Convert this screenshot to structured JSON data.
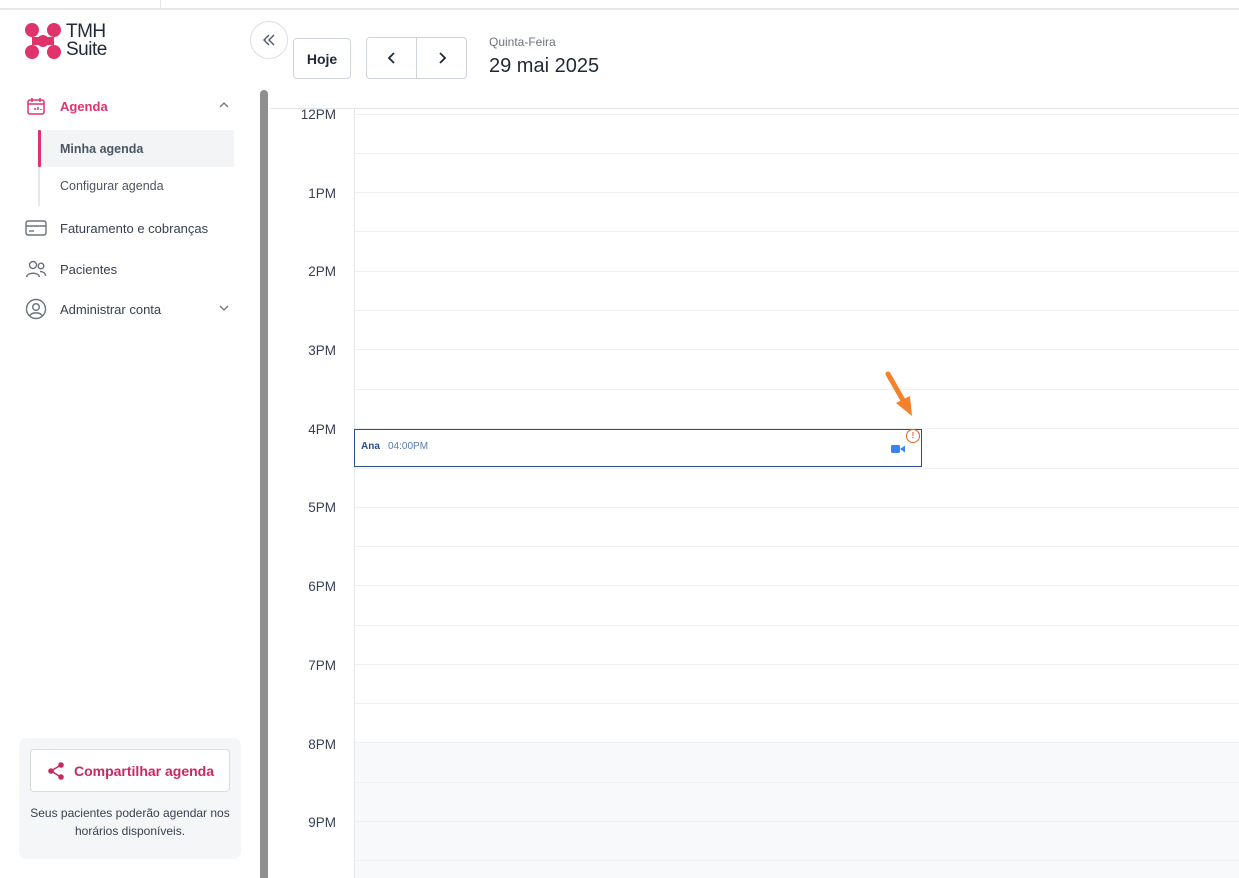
{
  "brand": {
    "name_line1": "TMH",
    "name_line2": "Suite",
    "accent": "#e0336c"
  },
  "sidebar": {
    "items": [
      {
        "label": "Agenda",
        "icon": "calendar-icon",
        "expanded": true
      },
      {
        "label": "Faturamento e cobranças",
        "icon": "credit-card-icon"
      },
      {
        "label": "Pacientes",
        "icon": "users-icon"
      },
      {
        "label": "Administrar conta",
        "icon": "user-circle-icon",
        "expanded": false
      }
    ],
    "agenda_sub": [
      {
        "label": "Minha agenda",
        "active": true
      },
      {
        "label": "Configurar agenda",
        "active": false
      }
    ],
    "share": {
      "button_label": "Compartilhar agenda",
      "note": "Seus pacientes poderão agendar nos horários disponíveis."
    }
  },
  "header": {
    "today_label": "Hoje",
    "weekday": "Quinta-Feira",
    "date": "29 mai 2025"
  },
  "calendar": {
    "hours": [
      "12PM",
      "1PM",
      "2PM",
      "3PM",
      "4PM",
      "5PM",
      "6PM",
      "7PM",
      "8PM",
      "9PM"
    ],
    "events": [
      {
        "name": "Ana",
        "time": "04:00PM",
        "type": "video",
        "warning_badge": "!"
      }
    ]
  }
}
